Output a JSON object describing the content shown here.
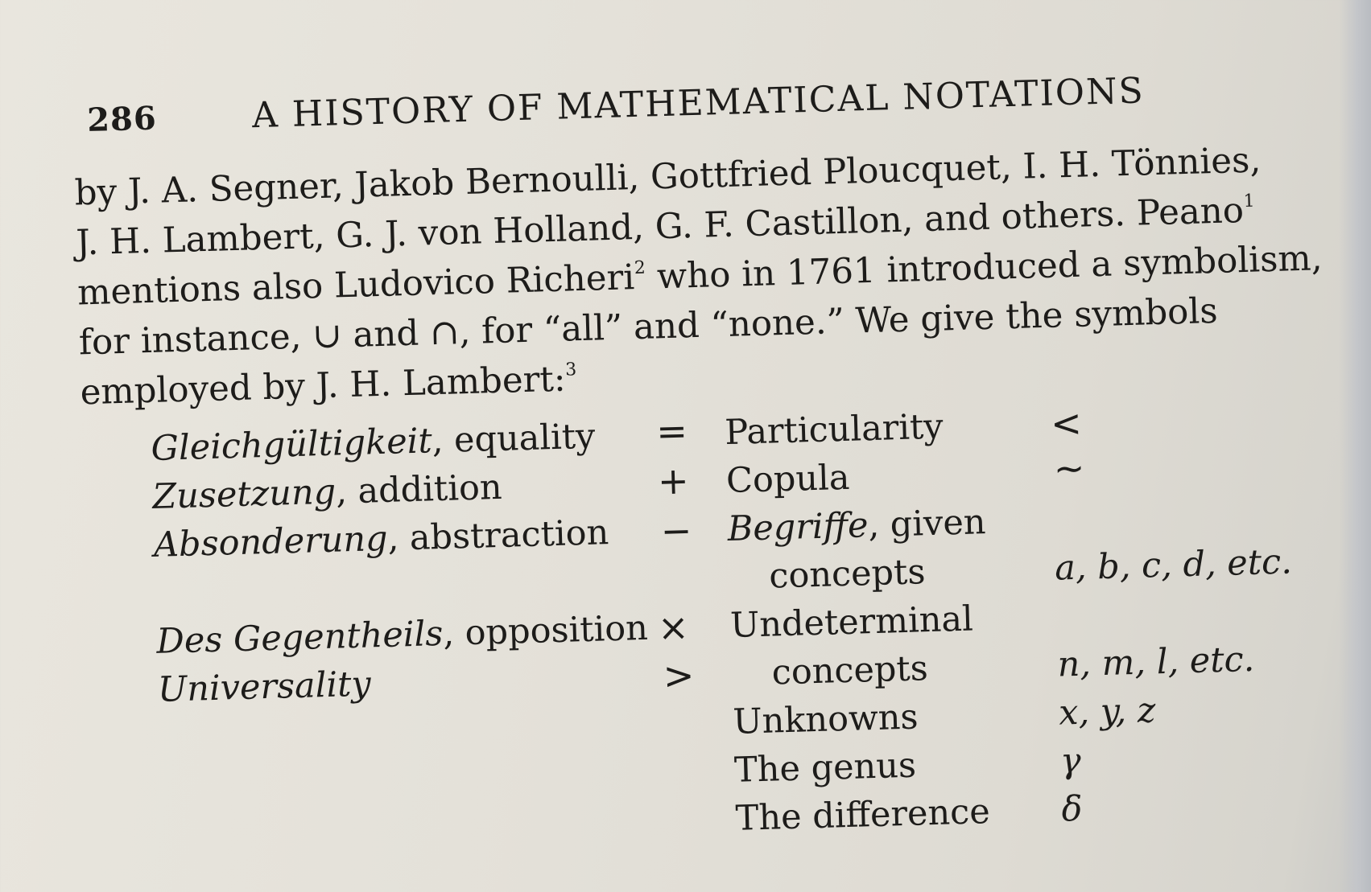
{
  "header": {
    "page_number": "286",
    "title": "A HISTORY OF MATHEMATICAL NOTATIONS"
  },
  "paragraph": {
    "line1": "by J. A. Segner, Jakob Bernoulli, Gottfried Ploucquet, I. H. Tönnies,",
    "line2_text": "J. H. Lambert, G. J. von Holland, G. F. Castillon, and others. Peano",
    "line2_note": "1",
    "line3_a": "mentions also Ludovico Richeri",
    "line3_note": "2",
    "line3_b": " who in 1761 introduced a symbolism,",
    "line4": "for instance, ∪ and ∩, for “all” and “none.” We give the symbols",
    "line5_text": "employed by J. H. Lambert:",
    "line5_note": "3"
  },
  "left_table": [
    {
      "term": "Gleichgültigkeit",
      "meaning": ", equality",
      "symbol": "="
    },
    {
      "term": "Zusetzung",
      "meaning": ", addition",
      "symbol": "+"
    },
    {
      "term": "Absonderung",
      "meaning": ", abstraction",
      "symbol": "−"
    },
    {
      "term": "Des Gegentheils",
      "meaning": ", opposition",
      "symbol": "×"
    },
    {
      "term": "Universality",
      "meaning": "",
      "symbol": ">"
    }
  ],
  "right_table": [
    {
      "term": "Particularity",
      "italic": false,
      "symbol": "<"
    },
    {
      "term": "Copula",
      "italic": false,
      "symbol": "~"
    },
    {
      "term": "Begriffe",
      "italic": true,
      "rest": ", given"
    },
    {
      "term": "concepts",
      "italic": false,
      "symbol": "a, b, c, d, etc."
    },
    {
      "term": "Undeterminal",
      "italic": false,
      "symbol": ""
    },
    {
      "term": "concepts",
      "italic": false,
      "symbol": "n, m, l, etc."
    },
    {
      "term": "Unknowns",
      "italic": false,
      "symbol": "x, y, z"
    },
    {
      "term": "The genus",
      "italic": false,
      "symbol": "γ"
    },
    {
      "term": "The difference",
      "italic": false,
      "symbol": "δ"
    }
  ]
}
